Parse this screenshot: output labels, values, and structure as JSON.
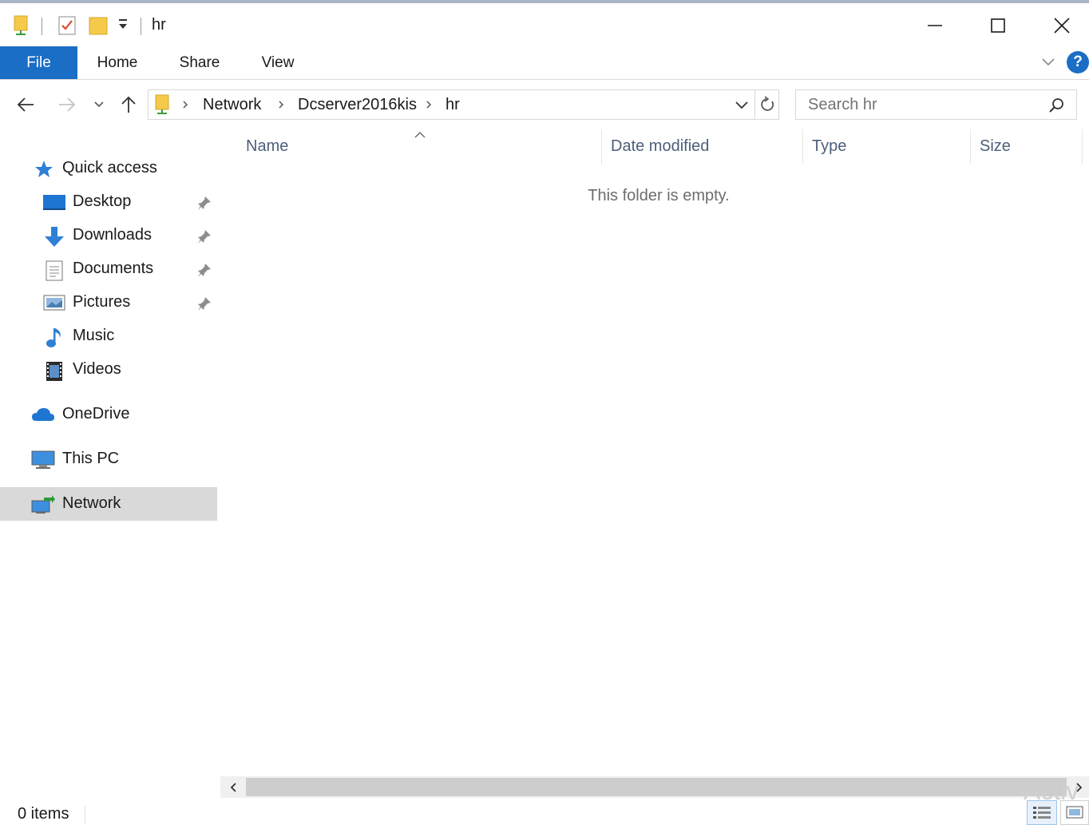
{
  "window": {
    "title": "hr",
    "minimize_icon": "minimize-icon",
    "maximize_icon": "maximize-icon",
    "close_icon": "close-icon"
  },
  "ribbon": {
    "tabs": [
      {
        "label": "File"
      },
      {
        "label": "Home"
      },
      {
        "label": "Share"
      },
      {
        "label": "View"
      }
    ],
    "help_label": "?"
  },
  "address": {
    "crumbs": [
      "Network",
      "Dcserver2016kis",
      "hr"
    ]
  },
  "search": {
    "placeholder": "Search hr"
  },
  "sidebar": {
    "quick_access": "Quick access",
    "items": [
      {
        "label": "Desktop",
        "icon": "desktop-icon",
        "pinned": true
      },
      {
        "label": "Downloads",
        "icon": "downloads-icon",
        "pinned": true
      },
      {
        "label": "Documents",
        "icon": "documents-icon",
        "pinned": true
      },
      {
        "label": "Pictures",
        "icon": "pictures-icon",
        "pinned": true
      },
      {
        "label": "Music",
        "icon": "music-icon",
        "pinned": false
      },
      {
        "label": "Videos",
        "icon": "videos-icon",
        "pinned": false
      }
    ],
    "onedrive": "OneDrive",
    "this_pc": "This PC",
    "network": "Network",
    "selected": "Network"
  },
  "columns": [
    "Name",
    "Date modified",
    "Type",
    "Size"
  ],
  "content": {
    "empty_message": "This folder is empty."
  },
  "status": {
    "items_text": "0 items",
    "watermark": "Activ"
  },
  "colors": {
    "accent": "#1a6ec6",
    "selected_bg": "#d9d9d9",
    "folder_yellow": "#f5c94a"
  }
}
